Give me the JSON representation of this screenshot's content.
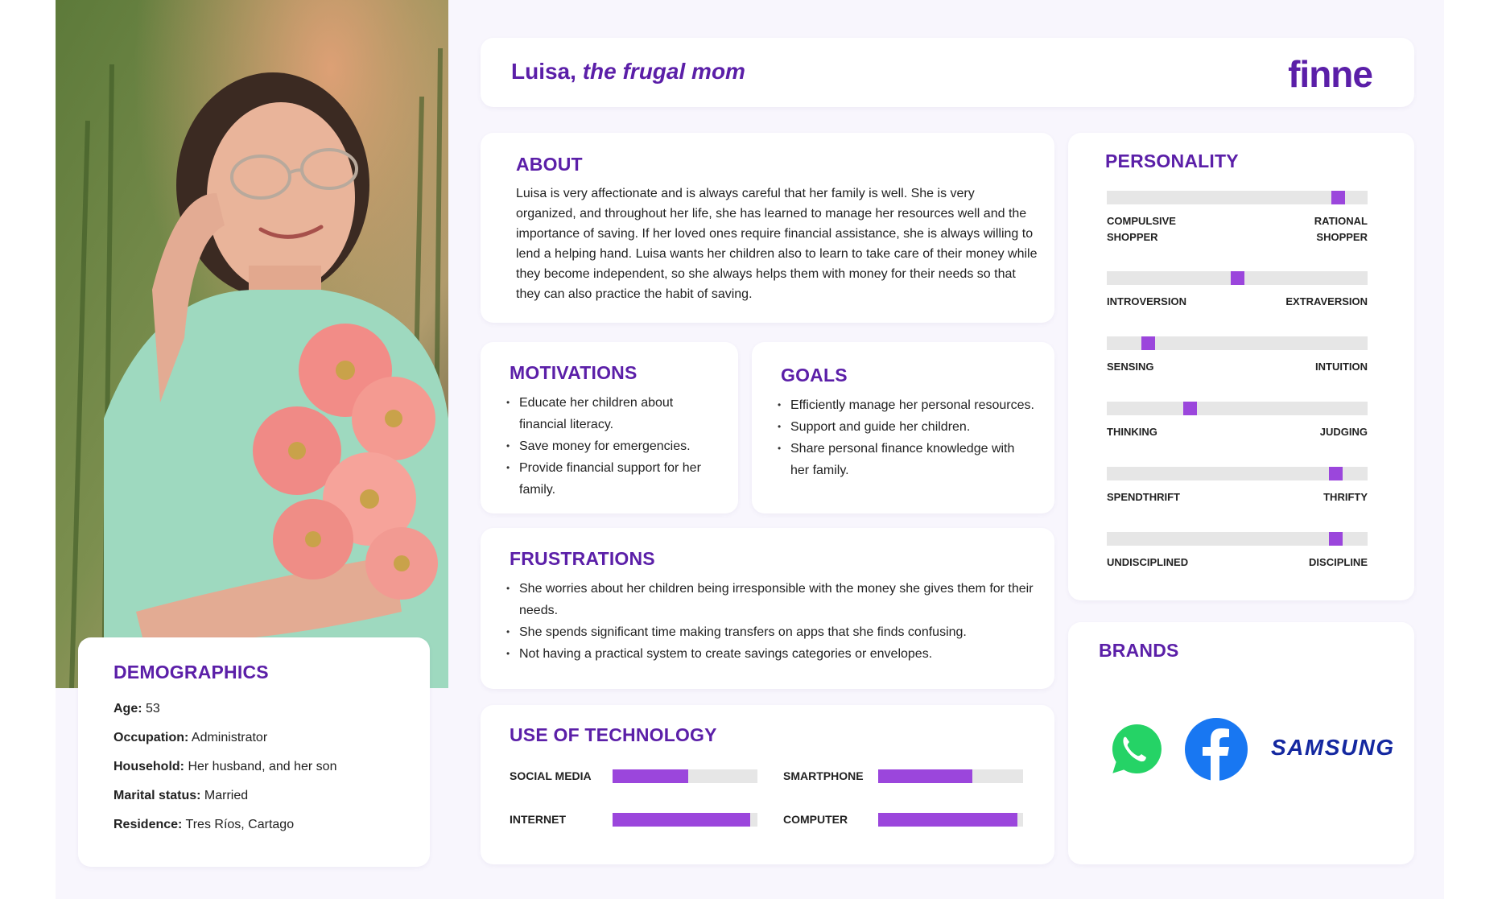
{
  "header": {
    "name": "Luisa,",
    "tagline": "the frugal mom",
    "logo": "finne"
  },
  "about": {
    "title": "ABOUT",
    "text": "Luisa is very affectionate and is always careful that her family is well. She is very organized, and throughout her life, she has learned to manage her resources well and the importance of saving. If her loved ones require financial assistance, she is always willing to lend a helping hand. Luisa wants her children also to learn to take care of their money while they become independent, so she always helps them with money for their needs so that they can also practice the habit of saving."
  },
  "motivations": {
    "title": "MOTIVATIONS",
    "items": [
      "Educate her children about financial literacy.",
      "Save money for emergencies.",
      "Provide financial support for her family."
    ]
  },
  "goals": {
    "title": "GOALS",
    "items": [
      "Efficiently manage her personal resources.",
      "Support and guide her children.",
      "Share personal finance knowledge with her family."
    ]
  },
  "frustrations": {
    "title": "FRUSTRATIONS",
    "items": [
      "She worries about her children being irresponsible with the money she gives them for their needs.",
      "She spends significant time making transfers on apps that she finds confusing.",
      "Not having a practical system to create savings categories or envelopes."
    ]
  },
  "technology": {
    "title": "USE OF TECHNOLOGY",
    "items": [
      {
        "label": "SOCIAL MEDIA",
        "level": 0.52
      },
      {
        "label": "SMARTPHONE",
        "level": 0.65
      },
      {
        "label": "INTERNET",
        "level": 0.95
      },
      {
        "label": "COMPUTER",
        "level": 0.96
      }
    ]
  },
  "personality": {
    "title": "PERSONALITY",
    "traits": [
      {
        "left": "COMPULSIVE\nSHOPPER",
        "right": "RATIONAL\nSHOPPER",
        "level": 0.91
      },
      {
        "left": "INTROVERSION",
        "right": "EXTRAVERSION",
        "level": 0.5
      },
      {
        "left": "SENSING",
        "right": "INTUITION",
        "level": 0.14
      },
      {
        "left": "THINKING",
        "right": "JUDGING",
        "level": 0.31
      },
      {
        "left": "SPENDTHRIFT",
        "right": "THRIFTY",
        "level": 0.9
      },
      {
        "left": "UNDISCIPLINED",
        "right": "DISCIPLINE",
        "level": 0.9
      }
    ]
  },
  "brands": {
    "title": "BRANDS",
    "items": [
      "whatsapp-logo",
      "facebook-logo",
      "SAMSUNG"
    ]
  },
  "demographics": {
    "title": "DEMOGRAPHICS",
    "rows": [
      {
        "key": "Age:",
        "value": "53"
      },
      {
        "key": "Occupation:",
        "value": "Administrator"
      },
      {
        "key": "Household:",
        "value": "Her husband, and her son"
      },
      {
        "key": "Marital status:",
        "value": "Married"
      },
      {
        "key": "Residence:",
        "value": "Tres Ríos, Cartago"
      }
    ]
  },
  "colors": {
    "accent": "#5b1fa8",
    "bar": "#9b46dc",
    "track": "#e6e6e6",
    "whatsapp": "#25d366",
    "facebook": "#1877f2",
    "samsung": "#1428a0"
  }
}
